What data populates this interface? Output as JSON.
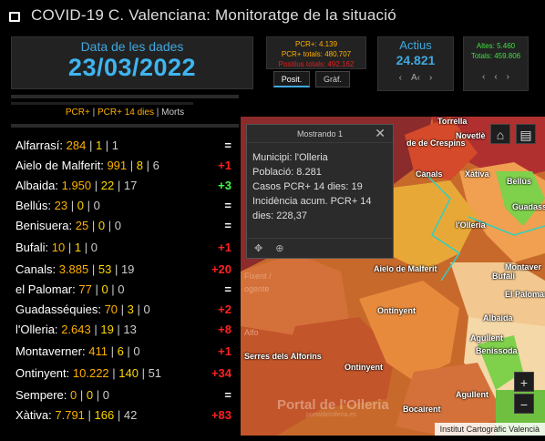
{
  "app": {
    "title": "COVID-19 C. Valenciana: Monitoratge de la situació"
  },
  "date_panel": {
    "label": "Data de les dades",
    "value": "23/03/2022"
  },
  "pcr_box": {
    "pcr": "PCR+: 4.139",
    "pcr_totals": "PCR+ totals: 480.707",
    "positius_totals": "Positius totals: 492.162"
  },
  "tabs": {
    "posit": "Posit.",
    "graf": "Gràf."
  },
  "actius": {
    "label": "Actius",
    "value": "24.821",
    "prev": "A‹",
    "next": ""
  },
  "altes": {
    "altes": "Altes: 5.460",
    "totals": "Totals: 459.806"
  },
  "list_header": {
    "pcr": "PCR+",
    "pcr14": "PCR+ 14 dies",
    "morts": "Morts"
  },
  "rows": [
    {
      "name": "Alfarrasí:",
      "v1": "284",
      "v2": "1",
      "v3": "1",
      "delta": "=",
      "tone": "white"
    },
    {
      "name": "Aielo de Malferit:",
      "v1": "991",
      "v2": "8",
      "v3": "6",
      "delta": "+1",
      "tone": "red"
    },
    {
      "name": "Albaida:",
      "v1": "1.950",
      "v2": "22",
      "v3": "17",
      "delta": "+3",
      "tone": "green"
    },
    {
      "name": "Bellús:",
      "v1": "23",
      "v2": "0",
      "v3": "0",
      "delta": "=",
      "tone": "white"
    },
    {
      "name": "Benisuera:",
      "v1": "25",
      "v2": "0",
      "v3": "0",
      "delta": "=",
      "tone": "white"
    },
    {
      "name": "Bufali:",
      "v1": "10",
      "v2": "1",
      "v3": "0",
      "delta": "+1",
      "tone": "red"
    },
    {
      "name": "Canals:",
      "v1": "3.885",
      "v2": "53",
      "v3": "19",
      "delta": "+20",
      "tone": "red"
    },
    {
      "name": "el Palomar:",
      "v1": "77",
      "v2": "0",
      "v3": "0",
      "delta": "=",
      "tone": "white"
    },
    {
      "name": "Guadasséquies:",
      "v1": "70",
      "v2": "3",
      "v3": "0",
      "delta": "+2",
      "tone": "red"
    },
    {
      "name": "l'Olleria:",
      "v1": "2.643",
      "v2": "19",
      "v3": "13",
      "delta": "+8",
      "tone": "red"
    },
    {
      "name": "Montaverner:",
      "v1": "411",
      "v2": "6",
      "v3": "0",
      "delta": "+1",
      "tone": "red"
    },
    {
      "name": "Ontinyent:",
      "v1": "10.222",
      "v2": "140",
      "v3": "51",
      "delta": "+34",
      "tone": "red"
    },
    {
      "name": "Sempere:",
      "v1": "0",
      "v2": "0",
      "v3": "0",
      "delta": "=",
      "tone": "white"
    },
    {
      "name": "Xàtiva:",
      "v1": "7.791",
      "v2": "166",
      "v3": "42",
      "delta": "+83",
      "tone": "red"
    }
  ],
  "popup": {
    "title": "Mostrando 1",
    "municipi": "Municipi: l'Olleria",
    "poblacio": "Població: 8.281",
    "casos": "Casos PCR+ 14 dies: 19",
    "incidencia": "Incidència acum. PCR+ 14 dies: 228,37"
  },
  "map": {
    "labels": {
      "torrella": "Torrella",
      "novetle": "Novetlè",
      "crespins": "de de Crespins",
      "canals": "Canals",
      "xativa": "Xàtiva",
      "bellus": "Bellús",
      "guadasse": "Guadasse",
      "lolleria": "l'Olleria",
      "aielo": "Aielo de Malferit",
      "montaverner": "Montaver",
      "bufali": "Bufali",
      "palomar": "El Palomar",
      "ontinyent": "Ontinyent",
      "albaida": "Albaida",
      "agullent": "Agullent",
      "benissoda": "Benissoda",
      "serres": "Serres dels Alforins",
      "bocairent": "Bocairent",
      "ontinyent2": "Ontinyent",
      "alfo": "Alfo",
      "ogente": "ogente",
      "fixent": "Fixent /",
      "agullent2": "Agullent"
    },
    "watermark": "Portal de l'Olleria",
    "watermark_sub": "portaldelolleria.es",
    "attribution": "Institut Cartogràfic Valencià",
    "zoom_in": "+",
    "zoom_out": "−"
  },
  "colors": {
    "accent_blue": "#3fb5f0",
    "pcr_amber": "#ffb000",
    "delta_red": "#ff2020",
    "delta_green": "#40ff40"
  }
}
